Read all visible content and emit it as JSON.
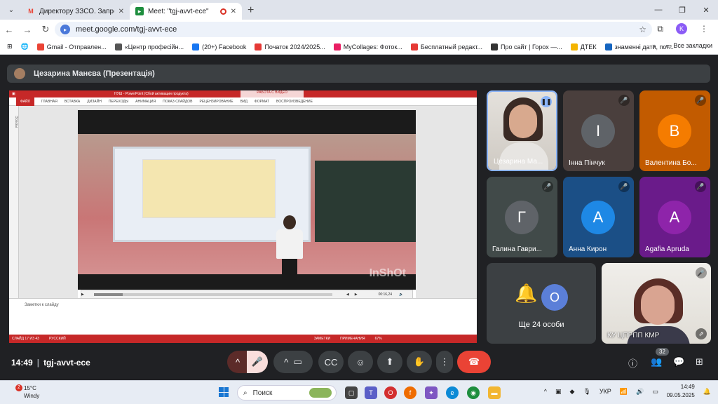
{
  "browser": {
    "tabs": [
      {
        "title": "Директору ЗЗСО. Запрошенн",
        "favicon": "gmail-icon",
        "active": false
      },
      {
        "title": "Meet: \"tgj-avvt-ece\"",
        "favicon": "meet-icon",
        "active": true
      }
    ],
    "url": "meet.google.com/tgj-avvt-ece",
    "profile_initial": "K",
    "bookmarks": [
      {
        "label": "Gmail - Отправлен...",
        "color": "#ea4335"
      },
      {
        "label": "«Центр професійн...",
        "color": "#555555"
      },
      {
        "label": "(20+) Facebook",
        "color": "#1877f2"
      },
      {
        "label": "Початок 2024/2025...",
        "color": "#e53935"
      },
      {
        "label": "MyCollages: Фоток...",
        "color": "#e91e63"
      },
      {
        "label": "Бесплатный редакт...",
        "color": "#e53935"
      },
      {
        "label": "Про сайт | Горох —...",
        "color": "#333333"
      },
      {
        "label": "ДТЕК",
        "color": "#f4b400"
      },
      {
        "label": "знаменні дати, пот...",
        "color": "#1565c0"
      }
    ],
    "bookmarks_more": "»",
    "all_bookmarks": "Все закладки"
  },
  "meet": {
    "presenter": "Цезарина Манєва (Презентація)",
    "powerpoint": {
      "title": "НУШ - PowerPoint (Сбой активации продукта)",
      "video_tools": "РАБОТА С ВИДЕО",
      "file_tab": "ФАЙЛ",
      "ribbon_tabs": [
        "ГЛАВНАЯ",
        "ВСТАВКА",
        "ДИЗАЙН",
        "ПЕРЕХОДЫ",
        "АНИМАЦИЯ",
        "ПОКАЗ СЛАЙДОВ",
        "РЕЦЕНЗИРОВАНИЕ",
        "ВИД",
        "ФОРМАТ",
        "ВОСПРОИЗВЕДЕНИЕ"
      ],
      "thumbs_label": "Эскизы",
      "video_watermark": "InShOt",
      "video_time": "00:16,24",
      "video_progress": 0.12,
      "notes_placeholder": "Заметки к слайду",
      "status_left": [
        "СЛАЙД 17 ИЗ 43",
        "РУССКИЙ"
      ],
      "status_right": [
        "ЗАМЕТКИ",
        "ПРИМЕЧАНИЯ",
        "67%"
      ]
    },
    "participants": [
      {
        "name": "Цезарина Ма...",
        "type": "video",
        "speaking": true,
        "muted": false
      },
      {
        "name": "Інна Пінчук",
        "initial": "І",
        "color": "#5f6368",
        "bg": "#4a3f3d",
        "muted": true
      },
      {
        "name": "Валентина Бо...",
        "initial": "В",
        "color": "#f57c00",
        "bg": "#c25b00",
        "muted": true
      },
      {
        "name": "Галина Гаври...",
        "initial": "Г",
        "color": "#5f6368",
        "bg": "#414a49",
        "muted": true
      },
      {
        "name": "Анна Кирон",
        "initial": "А",
        "color": "#1e88e5",
        "bg": "#1b4f86",
        "muted": true
      },
      {
        "name": "Agafia Apruda",
        "initial": "A",
        "color": "#8e24aa",
        "bg": "#6a1b8a",
        "muted": true
      }
    ],
    "others_initial": "О",
    "others_label": "Ще 24 особи",
    "pinned_name": "КУ ЦПРПП КМР",
    "time": "14:49",
    "meeting_code": "tgj-avvt-ece",
    "participant_count": "32"
  },
  "taskbar": {
    "weather_temp": "15°C",
    "weather_desc": "Windy",
    "weather_badge": "2",
    "search_placeholder": "Поиск",
    "language": "УКР",
    "time": "14:49",
    "date": "09.05.2025"
  }
}
